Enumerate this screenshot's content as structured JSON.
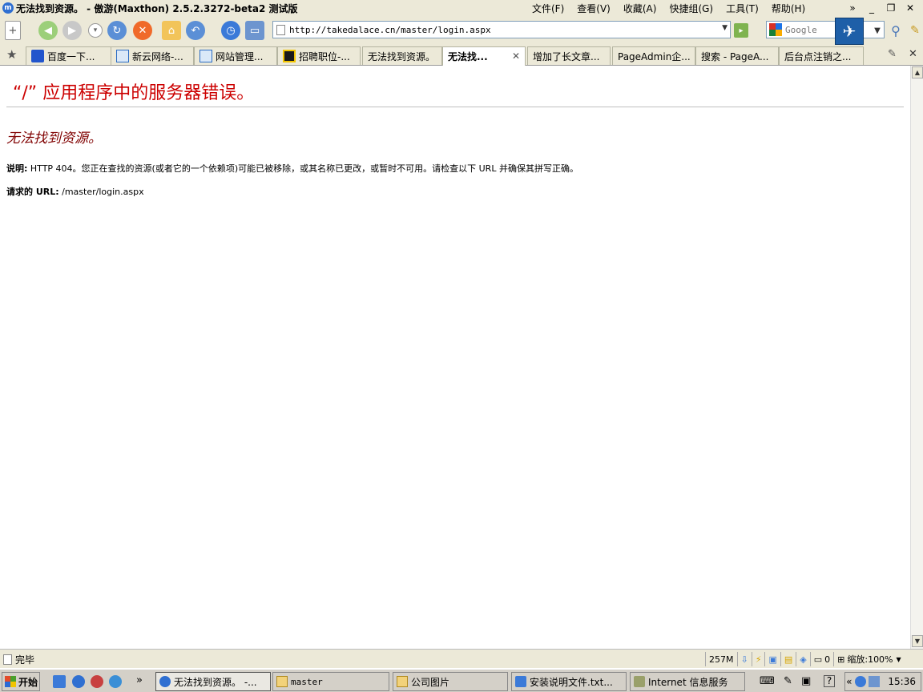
{
  "window": {
    "title": "无法找到资源。 - 傲游(Maxthon) 2.5.2.3272-beta2 测试版",
    "menus": [
      "文件(F)",
      "查看(V)",
      "收藏(A)",
      "快捷组(G)",
      "工具(T)",
      "帮助(H)"
    ],
    "controls": {
      "more": "»",
      "minimize": "_",
      "restore": "❐",
      "close": "✕"
    }
  },
  "toolbar": {
    "address": "http://takedalace.cn/master/login.aspx",
    "search_placeholder": "Google"
  },
  "tabs": [
    {
      "label": "百度一下...",
      "icon_color": "#2255cc",
      "active": false
    },
    {
      "label": "新云网络-...",
      "icon_color": "#2b6cc4",
      "active": false
    },
    {
      "label": "网站管理...",
      "icon_color": "#2b6cc4",
      "active": false
    },
    {
      "label": "招聘职位-...",
      "icon_color": "#c8a000",
      "active": false
    },
    {
      "label": "无法找到资源。",
      "icon_color": "",
      "active": false
    },
    {
      "label": "无法找...",
      "icon_color": "",
      "active": true
    },
    {
      "label": "增加了长文章...",
      "icon_color": "",
      "active": false
    },
    {
      "label": "PageAdmin企...",
      "icon_color": "",
      "active": false
    },
    {
      "label": "搜索 - PageA...",
      "icon_color": "",
      "active": false
    },
    {
      "label": "后台点注销之...",
      "icon_color": "",
      "active": false
    }
  ],
  "page": {
    "error_title": "“/” 应用程序中的服务器错误。",
    "error_subtitle": "无法找到资源。",
    "desc_label": "说明:",
    "desc_text": " HTTP 404。您正在查找的资源(或者它的一个依赖项)可能已被移除，或其名称已更改，或暂时不可用。请检查以下 URL 并确保其拼写正确。",
    "req_label": "请求的 URL:",
    "req_url": " /master/login.aspx"
  },
  "status": {
    "text": "完毕",
    "memory": "257M",
    "zoom": "缩放:100%",
    "popup_count": "0"
  },
  "taskbar": {
    "start": "开始",
    "tasks": [
      {
        "label": "无法找到资源。 -...",
        "active": true
      },
      {
        "label": "master",
        "active": false
      },
      {
        "label": "公司图片",
        "active": false
      },
      {
        "label": "安装说明文件.txt...",
        "active": false
      },
      {
        "label": "Internet 信息服务",
        "active": false
      }
    ],
    "clock": "15:36"
  },
  "colors": {
    "error_title": "#cc0000",
    "error_subtitle": "#800000",
    "chrome": "#ece9d8"
  }
}
